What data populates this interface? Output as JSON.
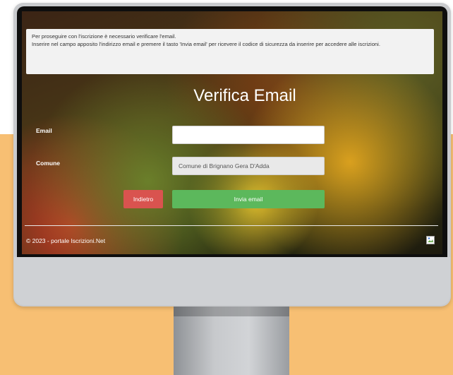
{
  "info": {
    "line1": "Per proseguire con l'iscrizione è necessario verificare l'email.",
    "line2": "Inserire nel campo apposito l'indirizzo email e premere il tasto 'Invia email' per ricevere il codice di sicurezza da inserire per accedere alle iscrizioni."
  },
  "form": {
    "title": "Verifica Email",
    "email_label": "Email",
    "email_value": "",
    "comune_label": "Comune",
    "comune_value": "Comune di  Brignano Gera D'Adda",
    "back_button": "Indietro",
    "send_button": "Invia email"
  },
  "footer": {
    "text": "© 2023 - portale Iscrizioni.Net",
    "image_icon": "broken-image-icon"
  },
  "colors": {
    "back_button": "#d9534f",
    "send_button": "#5cb85c",
    "background_accent": "#f7bf73"
  }
}
